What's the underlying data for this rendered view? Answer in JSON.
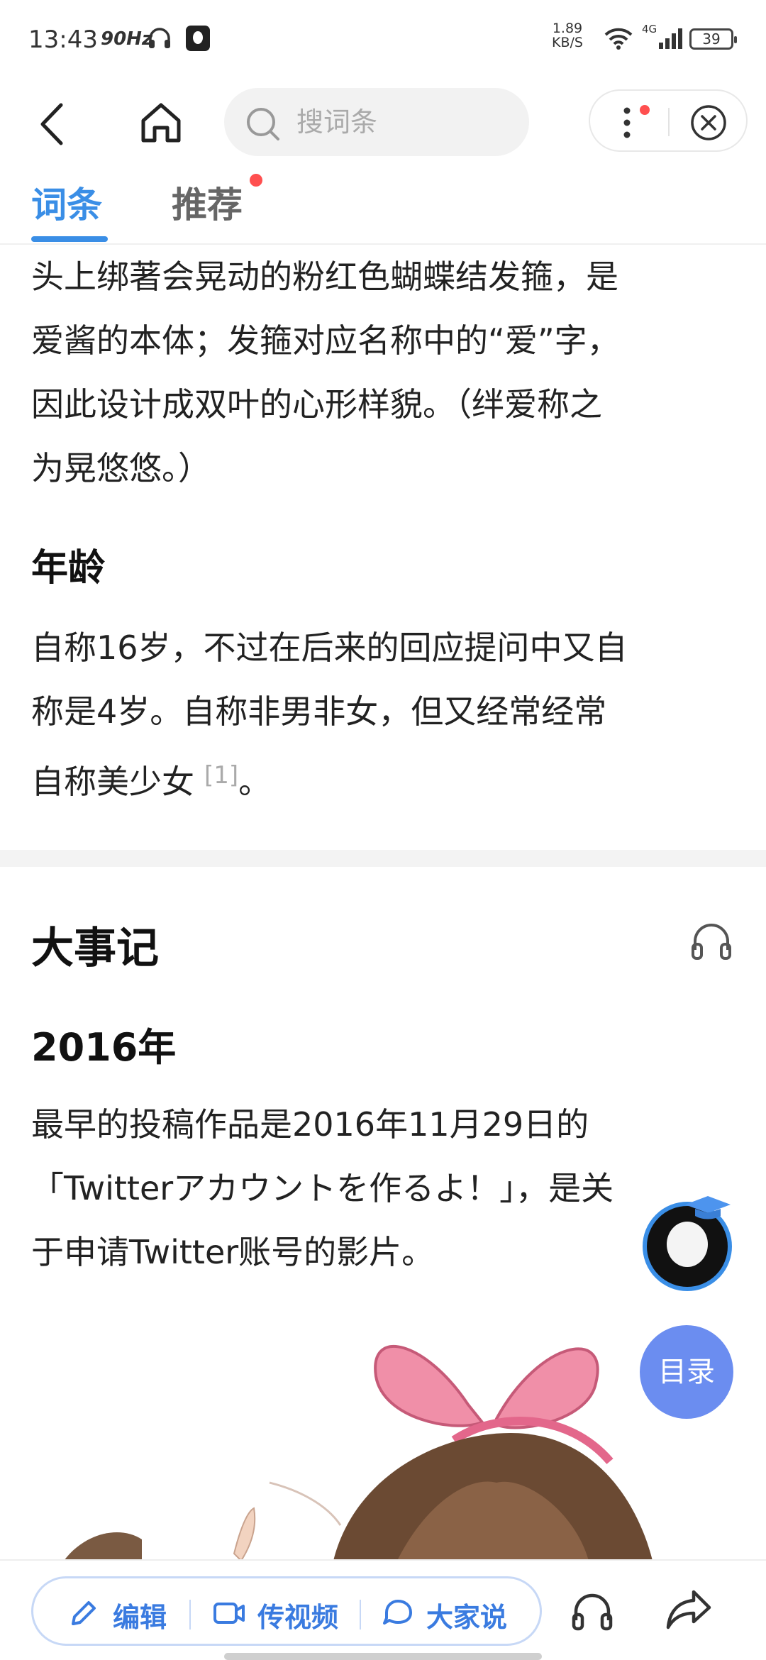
{
  "status_bar": {
    "time": "13:43",
    "refresh": "90Hz",
    "net_speed_value": "1.89",
    "net_speed_unit": "KB/S",
    "network": "4G",
    "battery": "39"
  },
  "top_bar": {
    "search_placeholder": "搜词条"
  },
  "tabs": [
    {
      "label": "词条",
      "active": true
    },
    {
      "label": "推荐",
      "active": false,
      "has_badge": true
    }
  ],
  "article": {
    "intro_paragraph_lines": [
      "头上绑著会晃动的粉红色蝴蝶结发箍，是",
      "爱酱的本体；发箍对应名称中的“爱”字，",
      "因此设计成双叶的心形样貌。（绊爱称之",
      "为晃悠悠。）"
    ],
    "age_heading": "年龄",
    "age_paragraph_lines": [
      "自称16岁，不过在后来的回应提问中又自",
      "称是4岁。自称非男非女，但又经常经常",
      "自称美少女"
    ],
    "age_ref": "[1]",
    "age_tail": "。",
    "events_heading": "大事记",
    "year_heading": "2016年",
    "events_paragraph_lines": [
      "最早的投稿作品是2016年11月29日的",
      "「Twitterアカウントを作るよ！」，是关",
      "于申请Twitter账号的影片。"
    ]
  },
  "floating": {
    "toc_label": "目录"
  },
  "bottom_bar": {
    "edit_label": "编辑",
    "video_label": "传视频",
    "discuss_label": "大家说"
  },
  "colors": {
    "accent": "#3a8ee6",
    "toc_button": "#6b8df0",
    "badge": "#ff4f4f"
  }
}
